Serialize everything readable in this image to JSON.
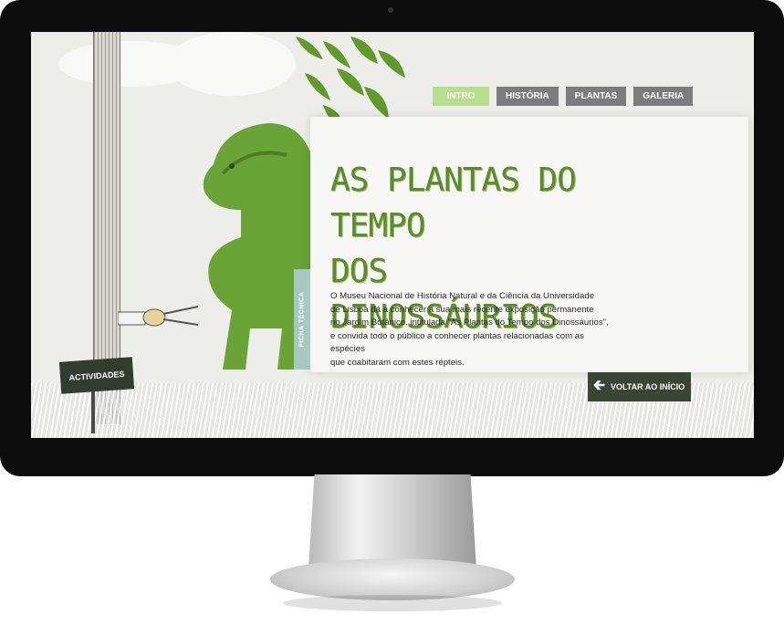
{
  "nav": {
    "tabs": [
      {
        "label": "INTRO",
        "active": true
      },
      {
        "label": "HISTÓRIA",
        "active": false
      },
      {
        "label": "PLANTAS",
        "active": false
      },
      {
        "label": "GALERIA",
        "active": false
      }
    ]
  },
  "hero": {
    "title_line1": "AS PLANTAS DO TEMPO",
    "title_line2": "DOS DINOSSÁURIOS",
    "intro_lines": [
      "O Museu Nacional de História Natural e da Ciência da Universidade",
      "de Lisboa dá a conhecer a sua mais recente exposição permanente",
      "no Jardim Botânico, intitulada \"As Plantas do Tempo dos Dinossáurios\",",
      "e convida todo o público a conhecer plantas relacionadas com as espécies",
      "que coabitaram com estes répteis."
    ]
  },
  "side_tab": {
    "label": "FICHA TÉCNICA"
  },
  "buttons": {
    "voltar_label": "VOLTAR AO INÍCIO",
    "actividades_label": "ACTIVIDADES"
  },
  "colors": {
    "accent_green": "#b7de8c",
    "title_green": "#5c8a2e",
    "tab_grey": "#7c7c7c",
    "dark_button": "#3a4536",
    "side_tab": "#a5c8c2"
  },
  "icons": {
    "back_arrow": "arrow-left-icon",
    "dinosaur": "dinosaur-topiary-icon"
  }
}
